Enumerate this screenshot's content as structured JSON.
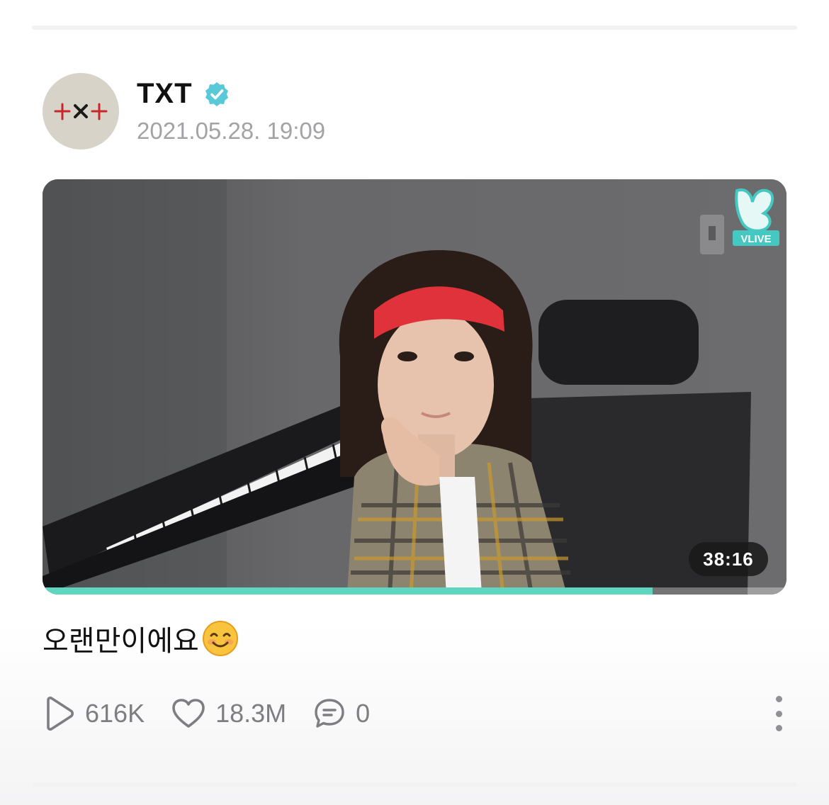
{
  "post": {
    "channel_name": "TXT",
    "date": "2021.05.28. 19:09",
    "avatar_logo_text": "+×+",
    "caption": "오랜만이에요",
    "caption_emoji": "smiling-face-icon"
  },
  "video": {
    "duration": "38:16",
    "progress": 0.82,
    "watermark": "VLIVE",
    "progress_color": "#5fd6c0"
  },
  "stats": {
    "plays": "616K",
    "likes": "18.3M",
    "comments": "0"
  },
  "colors": {
    "verified": "#59c9d8",
    "meta_text": "#a3a3a7",
    "stat_text": "#7d7d82"
  }
}
